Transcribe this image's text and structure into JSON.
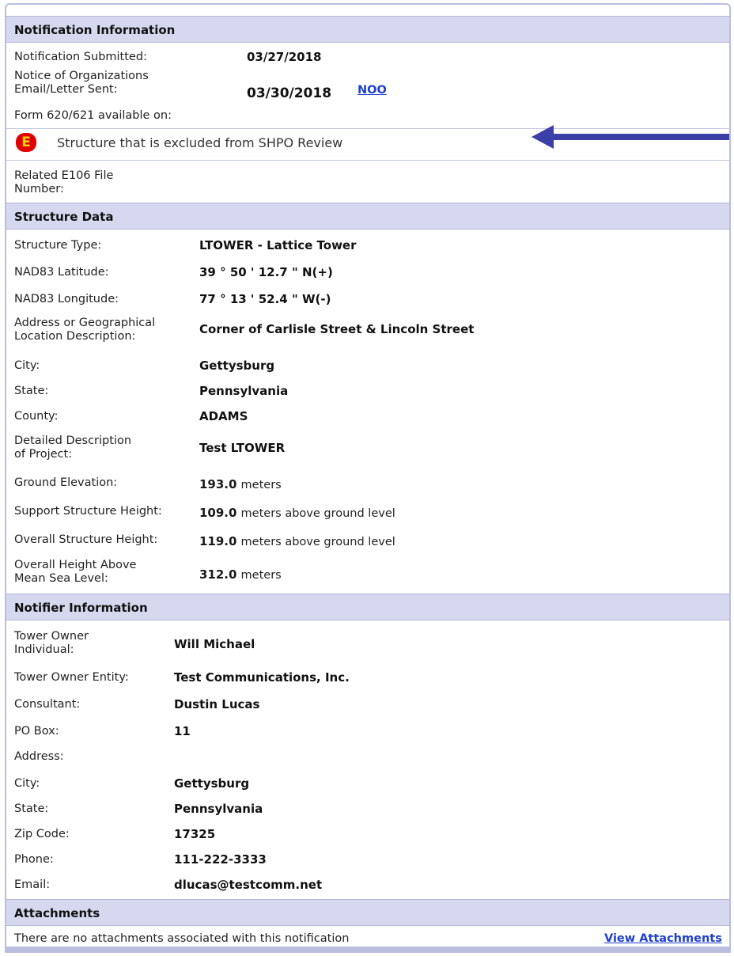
{
  "notification": {
    "header": "Notification Information",
    "submitted_label": "Notification Submitted:",
    "submitted_value": "03/27/2018",
    "noo_label_1": "Notice of Organizations",
    "noo_label_2": "Email/Letter Sent:",
    "noo_value": "03/30/2018",
    "noo_link": "NOO",
    "form_label": "Form 620/621 available on:",
    "exclusion_icon": "E",
    "exclusion_text": "Structure that is excluded from SHPO Review",
    "related_label_1": "Related E106 File",
    "related_label_2": "Number:"
  },
  "structure": {
    "header": "Structure Data",
    "rows": [
      {
        "label": "Structure Type:",
        "value": "LTOWER - Lattice Tower"
      },
      {
        "label": "NAD83 Latitude:",
        "value": "39 ° 50 ' 12.7 \" N(+)"
      },
      {
        "label": "NAD83 Longitude:",
        "value": "77 ° 13 ' 52.4 \" W(-)"
      },
      {
        "label": "Address or Geographical",
        "label2": "Location Description:",
        "value": "Corner of Carlisle Street & Lincoln Street"
      },
      {
        "label": "City:",
        "value": "Gettysburg"
      },
      {
        "label": "State:",
        "value": "Pennsylvania"
      },
      {
        "label": "County:",
        "value": "ADAMS"
      },
      {
        "label": "Detailed Description",
        "label2": "of Project:",
        "value": "Test LTOWER"
      },
      {
        "label": "Ground Elevation:",
        "value": "193.0",
        "unit": "meters"
      },
      {
        "label": "Support Structure Height:",
        "value": "109.0",
        "unit": "meters above ground level"
      },
      {
        "label": "Overall Structure Height:",
        "value": "119.0",
        "unit": "meters above ground level"
      },
      {
        "label": "Overall Height Above",
        "label2": "Mean Sea Level:",
        "value": "312.0",
        "unit": "meters"
      }
    ]
  },
  "notifier": {
    "header": "Notifier Information",
    "rows": [
      {
        "label": "Tower Owner",
        "label2": "Individual:",
        "value": "Will Michael"
      },
      {
        "label": "Tower Owner Entity:",
        "value": "Test Communications, Inc."
      },
      {
        "label": "Consultant:",
        "value": "Dustin Lucas"
      },
      {
        "label": "PO Box:",
        "value": "11"
      },
      {
        "label": "Address:",
        "value": ""
      },
      {
        "label": "City:",
        "value": "Gettysburg"
      },
      {
        "label": "State:",
        "value": "Pennsylvania"
      },
      {
        "label": "Zip Code:",
        "value": "17325"
      },
      {
        "label": "Phone:",
        "value": "111-222-3333"
      },
      {
        "label": "Email:",
        "value": "dlucas@testcomm.net"
      }
    ]
  },
  "attachments": {
    "header": "Attachments",
    "message": "There are no attachments associated with this notification",
    "link": "View Attachments"
  },
  "colors": {
    "header_bg": "#d6d8f0",
    "link": "#1f3fcf",
    "arrow": "#3b3fa8",
    "exclusion_icon_bg": "#e10000"
  }
}
